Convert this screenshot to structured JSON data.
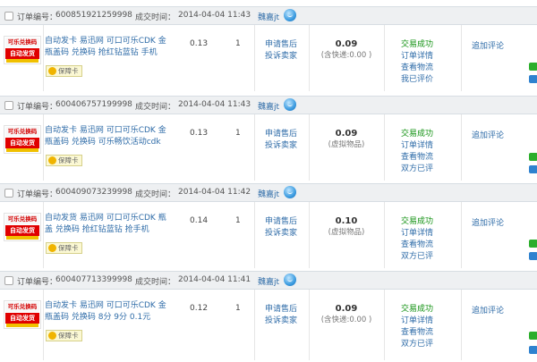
{
  "labels": {
    "order_no": "订单编号：",
    "deal_time": "成交时间：",
    "apply_refund": "申请售后",
    "complain": "投诉卖家",
    "add_review": "追加评论",
    "badge": "保障卡",
    "thumb_top": "可乐兑换码",
    "thumb_mid": "自动发货"
  },
  "orders": [
    {
      "order_id": "600851921259998",
      "time": "2014-04-04 11:43",
      "seller": "魏嘉jt",
      "title": "自动发卡 易迅网 可口可乐CDK 金瓶盖码 兑换码 抢红钻蓝钻 手机",
      "price": "0.13",
      "qty": "1",
      "total": "0.09",
      "total_note": "(含快递:0.00 )",
      "status": "交易成功",
      "status_links": [
        "订单详情",
        "查看物流",
        "我已评价"
      ]
    },
    {
      "order_id": "600406757199998",
      "time": "2014-04-04 11:43",
      "seller": "魏嘉jt",
      "title": "自动发卡 易迅网 可口可乐CDK 金瓶盖码 兑换码 可乐畅饮活动cdk",
      "price": "0.13",
      "qty": "1",
      "total": "0.09",
      "total_note": "(虚拟物品)",
      "status": "交易成功",
      "status_links": [
        "订单详情",
        "查看物流",
        "双方已评"
      ]
    },
    {
      "order_id": "600409073239998",
      "time": "2014-04-04 11:42",
      "seller": "魏嘉jt",
      "title": "自动发货 易迅网 可口可乐CDK 瓶盖 兑换码 抢红钻蓝钻 抢手机",
      "price": "0.14",
      "qty": "1",
      "total": "0.10",
      "total_note": "(虚拟物品)",
      "status": "交易成功",
      "status_links": [
        "订单详情",
        "查看物流",
        "双方已评"
      ]
    },
    {
      "order_id": "600407713399998",
      "time": "2014-04-04 11:41",
      "seller": "魏嘉jt",
      "title": "自动发卡 易迅网 可口可乐CDK 金瓶盖码 兑换码 8分 9分 0.1元",
      "price": "0.12",
      "qty": "1",
      "total": "0.09",
      "total_note": "(含快递:0.00 )",
      "status": "交易成功",
      "status_links": [
        "订单详情",
        "查看物流",
        "双方已评"
      ]
    }
  ],
  "colors": {
    "link": "#2f6ca8",
    "success": "#119111",
    "header_bg": "#eef0f2"
  },
  "icons": [
    "checkbox-icon",
    "wangwang-chat-icon",
    "guarantee-icon"
  ]
}
